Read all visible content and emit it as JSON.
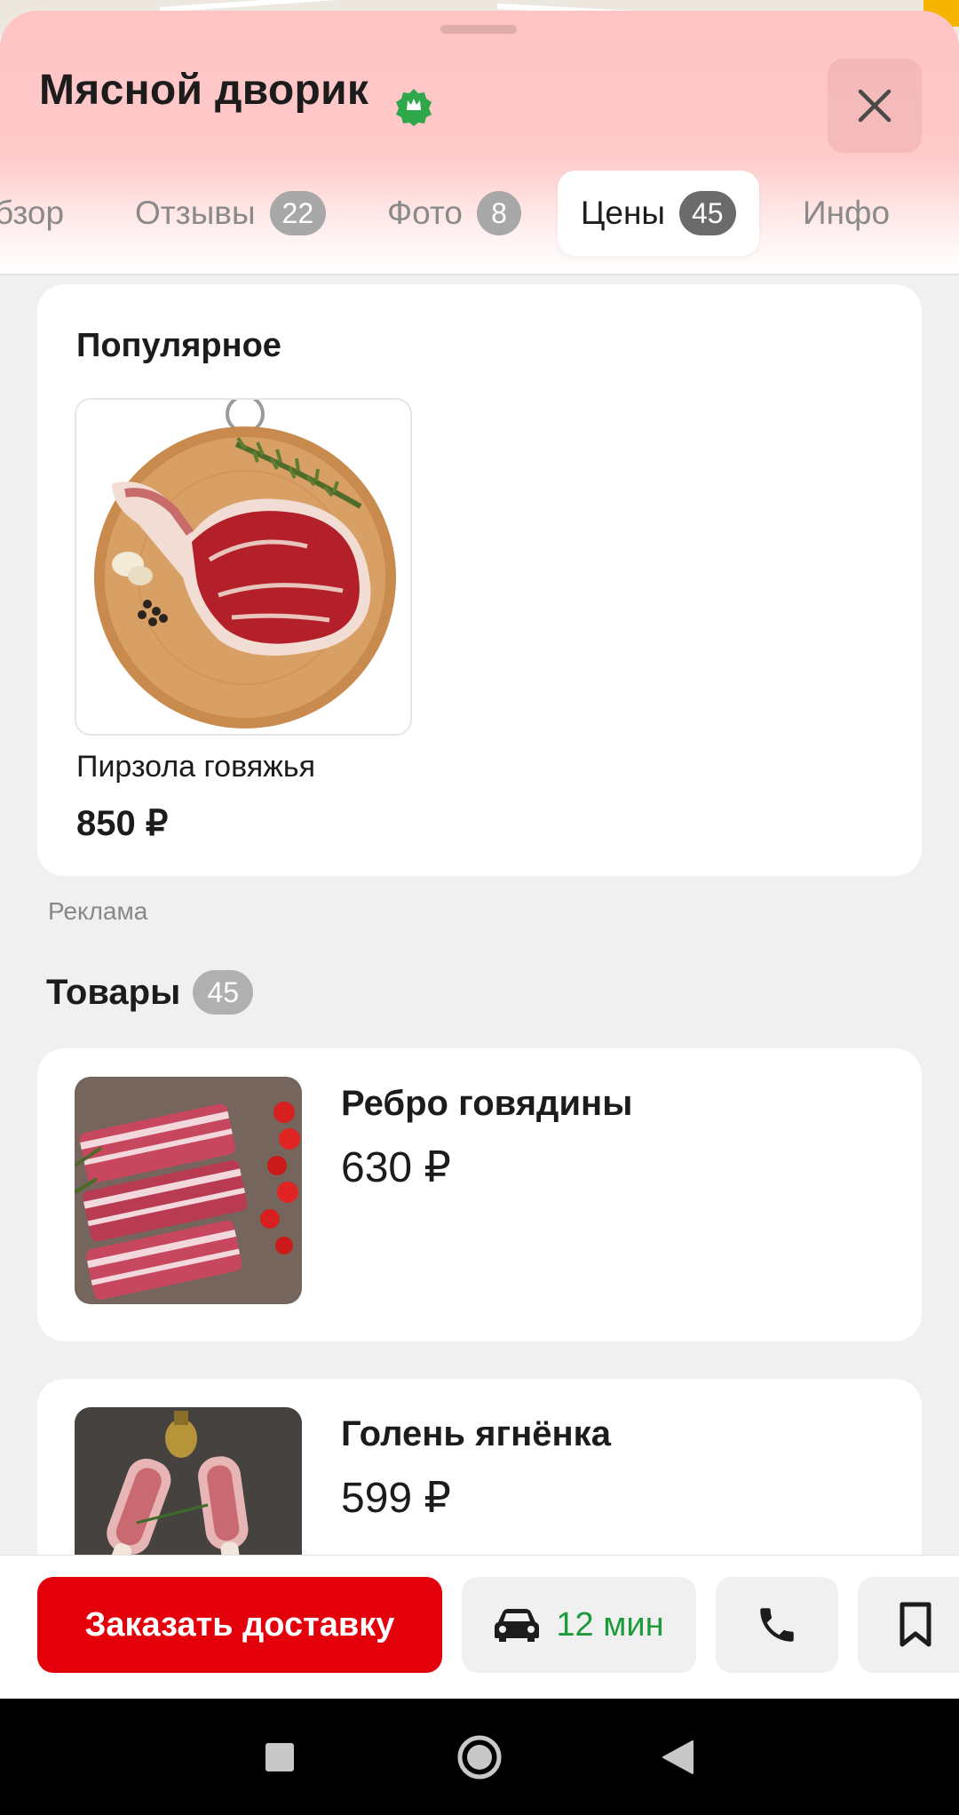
{
  "place": {
    "title": "Мясной дворик",
    "verified_icon": "verified-badge-icon",
    "close_icon": "close-icon"
  },
  "tabs": [
    {
      "label": "Обзор",
      "visible_label": "бзор",
      "badge": null,
      "active": false
    },
    {
      "label": "Отзывы",
      "badge": "22",
      "active": false
    },
    {
      "label": "Фото",
      "badge": "8",
      "active": false
    },
    {
      "label": "Цены",
      "badge": "45",
      "active": true
    },
    {
      "label": "Инфо",
      "badge": null,
      "active": false
    }
  ],
  "popular": {
    "title": "Популярное",
    "items": [
      {
        "name": "Пирзола говяжья",
        "price": "850 ₽",
        "image": "beef-steak-on-board-photo"
      }
    ],
    "ad_label": "Реклама"
  },
  "goods": {
    "title": "Товары",
    "count": "45",
    "items": [
      {
        "name": "Ребро говядины",
        "price": "630 ₽",
        "image": "beef-ribs-photo"
      },
      {
        "name": "Голень ягнёнка",
        "price": "599 ₽",
        "image": "lamb-shank-photo"
      }
    ]
  },
  "actions": {
    "order_label": "Заказать доставку",
    "eta_label": "12 мин",
    "eta_icon": "car-icon",
    "call_icon": "phone-icon",
    "bookmark_icon": "bookmark-icon"
  },
  "colors": {
    "accent_red": "#e4000a",
    "eta_green": "#1d9a3a",
    "header_pink": "#ffc4c4",
    "verified_green": "#2ea84a"
  },
  "system_nav": {
    "recents_icon": "square-icon",
    "home_icon": "circle-home-icon",
    "back_icon": "triangle-back-icon"
  }
}
